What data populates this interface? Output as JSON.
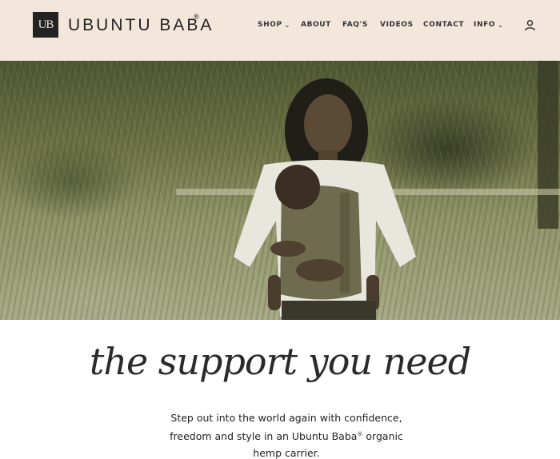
{
  "brand": {
    "logo_mark": "UB",
    "name": "UBUNTU BABA",
    "registered": "®"
  },
  "nav": {
    "items": [
      {
        "label": "SHOP",
        "has_dropdown": true
      },
      {
        "label": "ABOUT",
        "has_dropdown": false
      },
      {
        "label": "FAQ'S",
        "has_dropdown": false
      },
      {
        "label": "VIDEOS",
        "has_dropdown": false
      },
      {
        "label": "CONTACT",
        "has_dropdown": false
      },
      {
        "label": "INFO",
        "has_dropdown": true
      }
    ],
    "dropdown_glyph": "⌄",
    "account_icon": "user-icon"
  },
  "hero": {
    "image_subject": "woman carrying baby in carrier outdoors"
  },
  "content": {
    "headline": "the support you need",
    "intro_line1": "Step out into the world again with confidence,",
    "intro_line2_a": "freedom and style in an Ubuntu Baba",
    "intro_line2_reg": "®",
    "intro_line2_b": " organic",
    "intro_line3": "hemp carrier."
  },
  "colors": {
    "header_bg": "#f3e6da",
    "text_dark": "#232323"
  }
}
